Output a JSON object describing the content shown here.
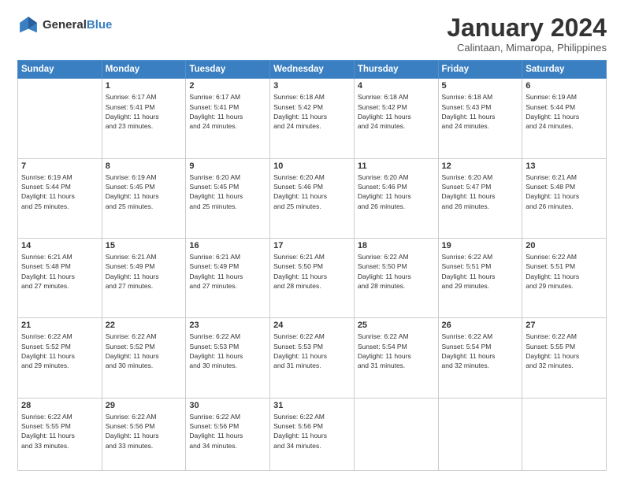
{
  "header": {
    "logo_general": "General",
    "logo_blue": "Blue",
    "month_title": "January 2024",
    "subtitle": "Calintaan, Mimaropa, Philippines"
  },
  "columns": [
    "Sunday",
    "Monday",
    "Tuesday",
    "Wednesday",
    "Thursday",
    "Friday",
    "Saturday"
  ],
  "weeks": [
    [
      {
        "day": "",
        "info": ""
      },
      {
        "day": "1",
        "info": "Sunrise: 6:17 AM\nSunset: 5:41 PM\nDaylight: 11 hours\nand 23 minutes."
      },
      {
        "day": "2",
        "info": "Sunrise: 6:17 AM\nSunset: 5:41 PM\nDaylight: 11 hours\nand 24 minutes."
      },
      {
        "day": "3",
        "info": "Sunrise: 6:18 AM\nSunset: 5:42 PM\nDaylight: 11 hours\nand 24 minutes."
      },
      {
        "day": "4",
        "info": "Sunrise: 6:18 AM\nSunset: 5:42 PM\nDaylight: 11 hours\nand 24 minutes."
      },
      {
        "day": "5",
        "info": "Sunrise: 6:18 AM\nSunset: 5:43 PM\nDaylight: 11 hours\nand 24 minutes."
      },
      {
        "day": "6",
        "info": "Sunrise: 6:19 AM\nSunset: 5:44 PM\nDaylight: 11 hours\nand 24 minutes."
      }
    ],
    [
      {
        "day": "7",
        "info": "Sunrise: 6:19 AM\nSunset: 5:44 PM\nDaylight: 11 hours\nand 25 minutes."
      },
      {
        "day": "8",
        "info": "Sunrise: 6:19 AM\nSunset: 5:45 PM\nDaylight: 11 hours\nand 25 minutes."
      },
      {
        "day": "9",
        "info": "Sunrise: 6:20 AM\nSunset: 5:45 PM\nDaylight: 11 hours\nand 25 minutes."
      },
      {
        "day": "10",
        "info": "Sunrise: 6:20 AM\nSunset: 5:46 PM\nDaylight: 11 hours\nand 25 minutes."
      },
      {
        "day": "11",
        "info": "Sunrise: 6:20 AM\nSunset: 5:46 PM\nDaylight: 11 hours\nand 26 minutes."
      },
      {
        "day": "12",
        "info": "Sunrise: 6:20 AM\nSunset: 5:47 PM\nDaylight: 11 hours\nand 26 minutes."
      },
      {
        "day": "13",
        "info": "Sunrise: 6:21 AM\nSunset: 5:48 PM\nDaylight: 11 hours\nand 26 minutes."
      }
    ],
    [
      {
        "day": "14",
        "info": "Sunrise: 6:21 AM\nSunset: 5:48 PM\nDaylight: 11 hours\nand 27 minutes."
      },
      {
        "day": "15",
        "info": "Sunrise: 6:21 AM\nSunset: 5:49 PM\nDaylight: 11 hours\nand 27 minutes."
      },
      {
        "day": "16",
        "info": "Sunrise: 6:21 AM\nSunset: 5:49 PM\nDaylight: 11 hours\nand 27 minutes."
      },
      {
        "day": "17",
        "info": "Sunrise: 6:21 AM\nSunset: 5:50 PM\nDaylight: 11 hours\nand 28 minutes."
      },
      {
        "day": "18",
        "info": "Sunrise: 6:22 AM\nSunset: 5:50 PM\nDaylight: 11 hours\nand 28 minutes."
      },
      {
        "day": "19",
        "info": "Sunrise: 6:22 AM\nSunset: 5:51 PM\nDaylight: 11 hours\nand 29 minutes."
      },
      {
        "day": "20",
        "info": "Sunrise: 6:22 AM\nSunset: 5:51 PM\nDaylight: 11 hours\nand 29 minutes."
      }
    ],
    [
      {
        "day": "21",
        "info": "Sunrise: 6:22 AM\nSunset: 5:52 PM\nDaylight: 11 hours\nand 29 minutes."
      },
      {
        "day": "22",
        "info": "Sunrise: 6:22 AM\nSunset: 5:52 PM\nDaylight: 11 hours\nand 30 minutes."
      },
      {
        "day": "23",
        "info": "Sunrise: 6:22 AM\nSunset: 5:53 PM\nDaylight: 11 hours\nand 30 minutes."
      },
      {
        "day": "24",
        "info": "Sunrise: 6:22 AM\nSunset: 5:53 PM\nDaylight: 11 hours\nand 31 minutes."
      },
      {
        "day": "25",
        "info": "Sunrise: 6:22 AM\nSunset: 5:54 PM\nDaylight: 11 hours\nand 31 minutes."
      },
      {
        "day": "26",
        "info": "Sunrise: 6:22 AM\nSunset: 5:54 PM\nDaylight: 11 hours\nand 32 minutes."
      },
      {
        "day": "27",
        "info": "Sunrise: 6:22 AM\nSunset: 5:55 PM\nDaylight: 11 hours\nand 32 minutes."
      }
    ],
    [
      {
        "day": "28",
        "info": "Sunrise: 6:22 AM\nSunset: 5:55 PM\nDaylight: 11 hours\nand 33 minutes."
      },
      {
        "day": "29",
        "info": "Sunrise: 6:22 AM\nSunset: 5:56 PM\nDaylight: 11 hours\nand 33 minutes."
      },
      {
        "day": "30",
        "info": "Sunrise: 6:22 AM\nSunset: 5:56 PM\nDaylight: 11 hours\nand 34 minutes."
      },
      {
        "day": "31",
        "info": "Sunrise: 6:22 AM\nSunset: 5:56 PM\nDaylight: 11 hours\nand 34 minutes."
      },
      {
        "day": "",
        "info": ""
      },
      {
        "day": "",
        "info": ""
      },
      {
        "day": "",
        "info": ""
      }
    ]
  ]
}
